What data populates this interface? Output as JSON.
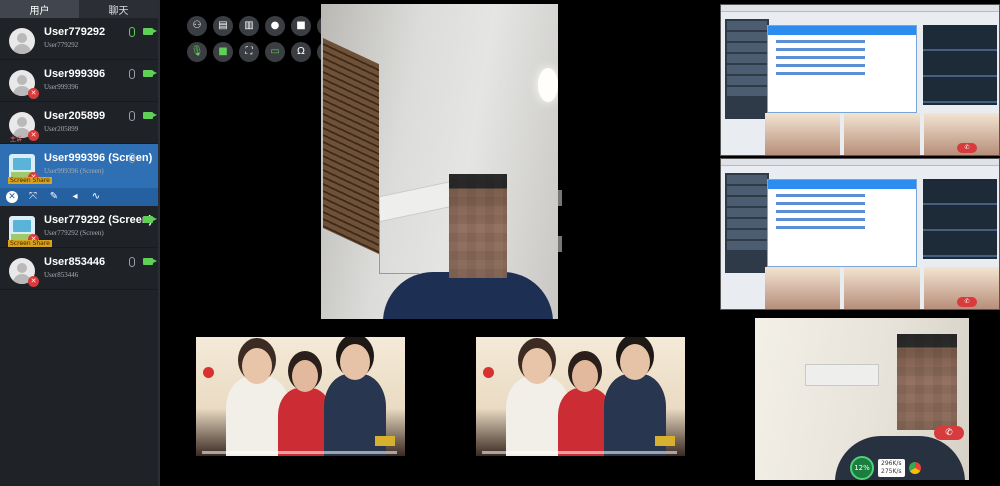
{
  "sidebar": {
    "tabs": [
      {
        "label": "用户"
      },
      {
        "label": "聊天"
      }
    ],
    "users": [
      {
        "name": "User779292",
        "sub": "User779292",
        "tag": ""
      },
      {
        "name": "User999396",
        "sub": "User999396",
        "tag": ""
      },
      {
        "name": "User205899",
        "sub": "User205899",
        "tag": "主讲"
      },
      {
        "name": "User999396 (Screen)",
        "sub": "User999396 (Screen)",
        "tag": "Screen Share"
      },
      {
        "name": "User779292 (Screen)",
        "sub": "User779292 (Screen)",
        "tag": "Screen Share"
      },
      {
        "name": "User853446",
        "sub": "User853446",
        "tag": ""
      }
    ]
  },
  "stats": {
    "cpu": "12%",
    "up": "296K/s",
    "down": "275K/s"
  },
  "colors": {
    "accent": "#2f6fb4",
    "green": "#5fcf58",
    "hangup": "#d83b3b"
  }
}
